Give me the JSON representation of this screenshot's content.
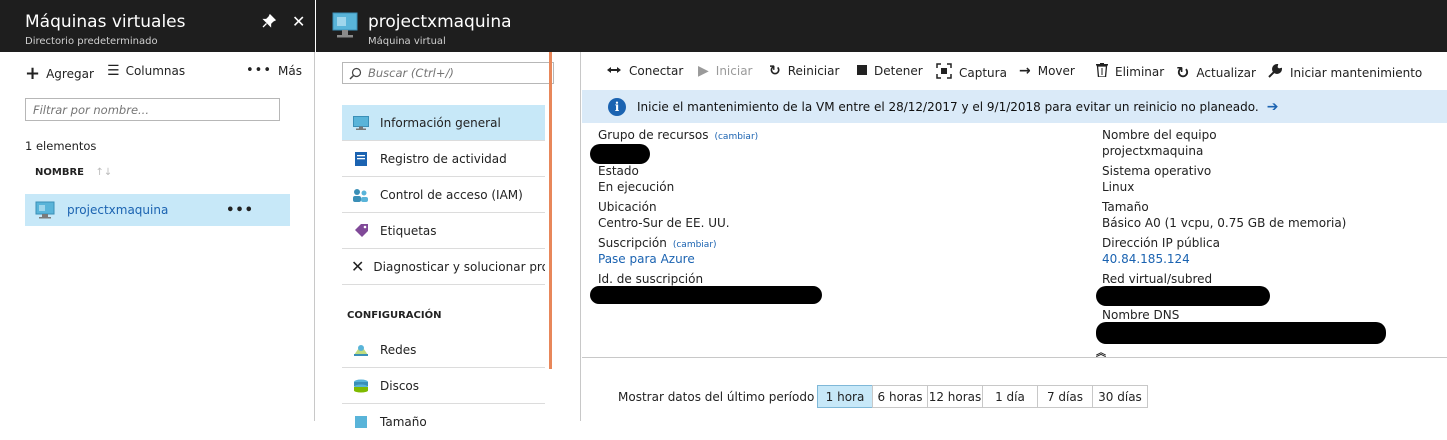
{
  "blade1": {
    "title": "Máquinas virtuales",
    "subtitle": "Directorio predeterminado",
    "toolbar": {
      "add": "Agregar",
      "columns": "Columnas",
      "more": "Más"
    },
    "filter_placeholder": "Filtrar por nombre...",
    "count": "1 elementos",
    "column_header": "NOMBRE",
    "rows": [
      {
        "name": "projectxmaquina"
      }
    ]
  },
  "blade2": {
    "title": "projectxmaquina",
    "subtitle": "Máquina virtual",
    "search_placeholder": "Buscar (Ctrl+/)",
    "menu": [
      {
        "label": "Información general",
        "icon": "overview-icon",
        "active": true
      },
      {
        "label": "Registro de actividad",
        "icon": "activity-log-icon",
        "active": false
      },
      {
        "label": "Control de acceso (IAM)",
        "icon": "iam-icon",
        "active": false
      },
      {
        "label": "Etiquetas",
        "icon": "tag-icon",
        "active": false
      },
      {
        "label": "Diagnosticar y solucionar pro...",
        "icon": "tools-icon",
        "active": false
      }
    ],
    "config_section": "CONFIGURACIÓN",
    "config_menu": [
      {
        "label": "Redes",
        "icon": "network-icon"
      },
      {
        "label": "Discos",
        "icon": "disks-icon"
      },
      {
        "label": "Tamaño",
        "icon": "size-icon"
      }
    ],
    "commands": {
      "connect": "Conectar",
      "start": "Iniciar",
      "restart": "Reiniciar",
      "stop": "Detener",
      "capture": "Captura",
      "move": "Mover",
      "delete": "Eliminar",
      "refresh": "Actualizar",
      "maintenance": "Iniciar mantenimiento"
    },
    "banner": "Inicie el mantenimiento de la VM entre el 28/12/2017 y el 9/1/2018 para evitar un reinicio no planeado.",
    "essentials": {
      "change_label": "(cambiar)",
      "resource_group_label": "Grupo de recursos",
      "status_label": "Estado",
      "status_value": "En ejecución",
      "location_label": "Ubicación",
      "location_value": "Centro-Sur de EE. UU.",
      "subscription_label": "Suscripción",
      "subscription_value": "Pase para Azure",
      "subscription_id_label": "Id. de suscripción",
      "computer_name_label": "Nombre del equipo",
      "computer_name_value": "projectxmaquina",
      "os_label": "Sistema operativo",
      "os_value": "Linux",
      "size_label": "Tamaño",
      "size_value": "Básico A0 (1 vcpu, 0.75 GB de memoria)",
      "public_ip_label": "Dirección IP pública",
      "public_ip_value": "40.84.185.124",
      "vnet_label": "Red virtual/subred",
      "dns_label": "Nombre DNS"
    },
    "time_range_label": "Mostrar datos del último período de:",
    "time_ranges": [
      "1 hora",
      "6 horas",
      "12 horas",
      "1 día",
      "7 días",
      "30 días"
    ],
    "selected_time_range": "1 hora"
  },
  "colors": {
    "header_bg": "#1e1e1e",
    "accent_blue": "#1b63b1",
    "selected_bg": "#c7e8f8",
    "banner_bg": "#daeaf8",
    "scroll_accent": "#e8875a"
  }
}
